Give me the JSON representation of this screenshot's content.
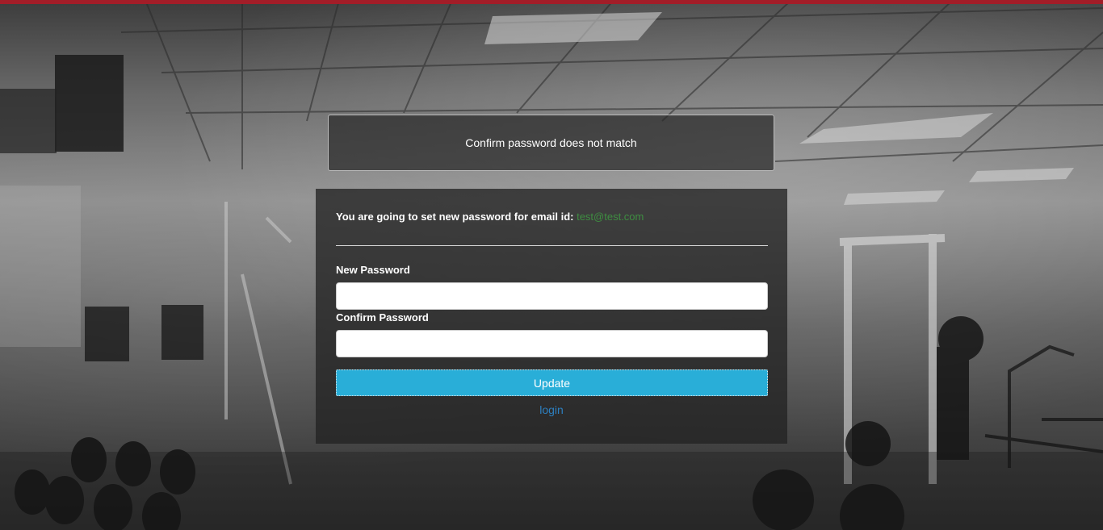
{
  "alert": {
    "message": "Confirm password does not match"
  },
  "form": {
    "notice_text": "You are going to set new password for email id: ",
    "email": "test@test.com",
    "new_password_label": "New Password",
    "new_password_value": "",
    "confirm_password_label": "Confirm Password",
    "confirm_password_value": "",
    "update_button_label": "Update",
    "login_link_label": "login"
  },
  "colors": {
    "top_bar": "#a21d28",
    "update_button": "#29aed8",
    "email_text": "#3e8e41",
    "login_link": "#2d7fbf"
  }
}
